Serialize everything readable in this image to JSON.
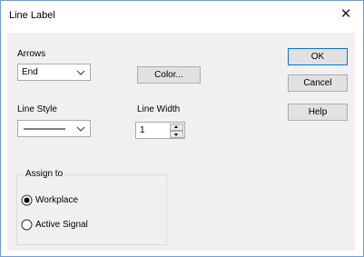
{
  "window": {
    "title": "Line Label",
    "close_glyph": "✕"
  },
  "arrows": {
    "label": "Arrows",
    "selected": "End"
  },
  "color_button": "Color...",
  "line_style": {
    "label": "Line Style"
  },
  "line_width": {
    "label": "Line Width",
    "value": "1"
  },
  "buttons": {
    "ok": "OK",
    "cancel": "Cancel",
    "help": "Help"
  },
  "assign_to": {
    "label": "Assign to",
    "options": [
      {
        "label": "Workplace",
        "selected": true
      },
      {
        "label": "Active Signal",
        "selected": false
      }
    ]
  },
  "icons": {
    "close": "close-icon",
    "chevron": "chevron-down-icon"
  },
  "colors": {
    "accent": "#0078d7",
    "window_border": "#6f9fd8",
    "panel": "#f0f0f0"
  }
}
